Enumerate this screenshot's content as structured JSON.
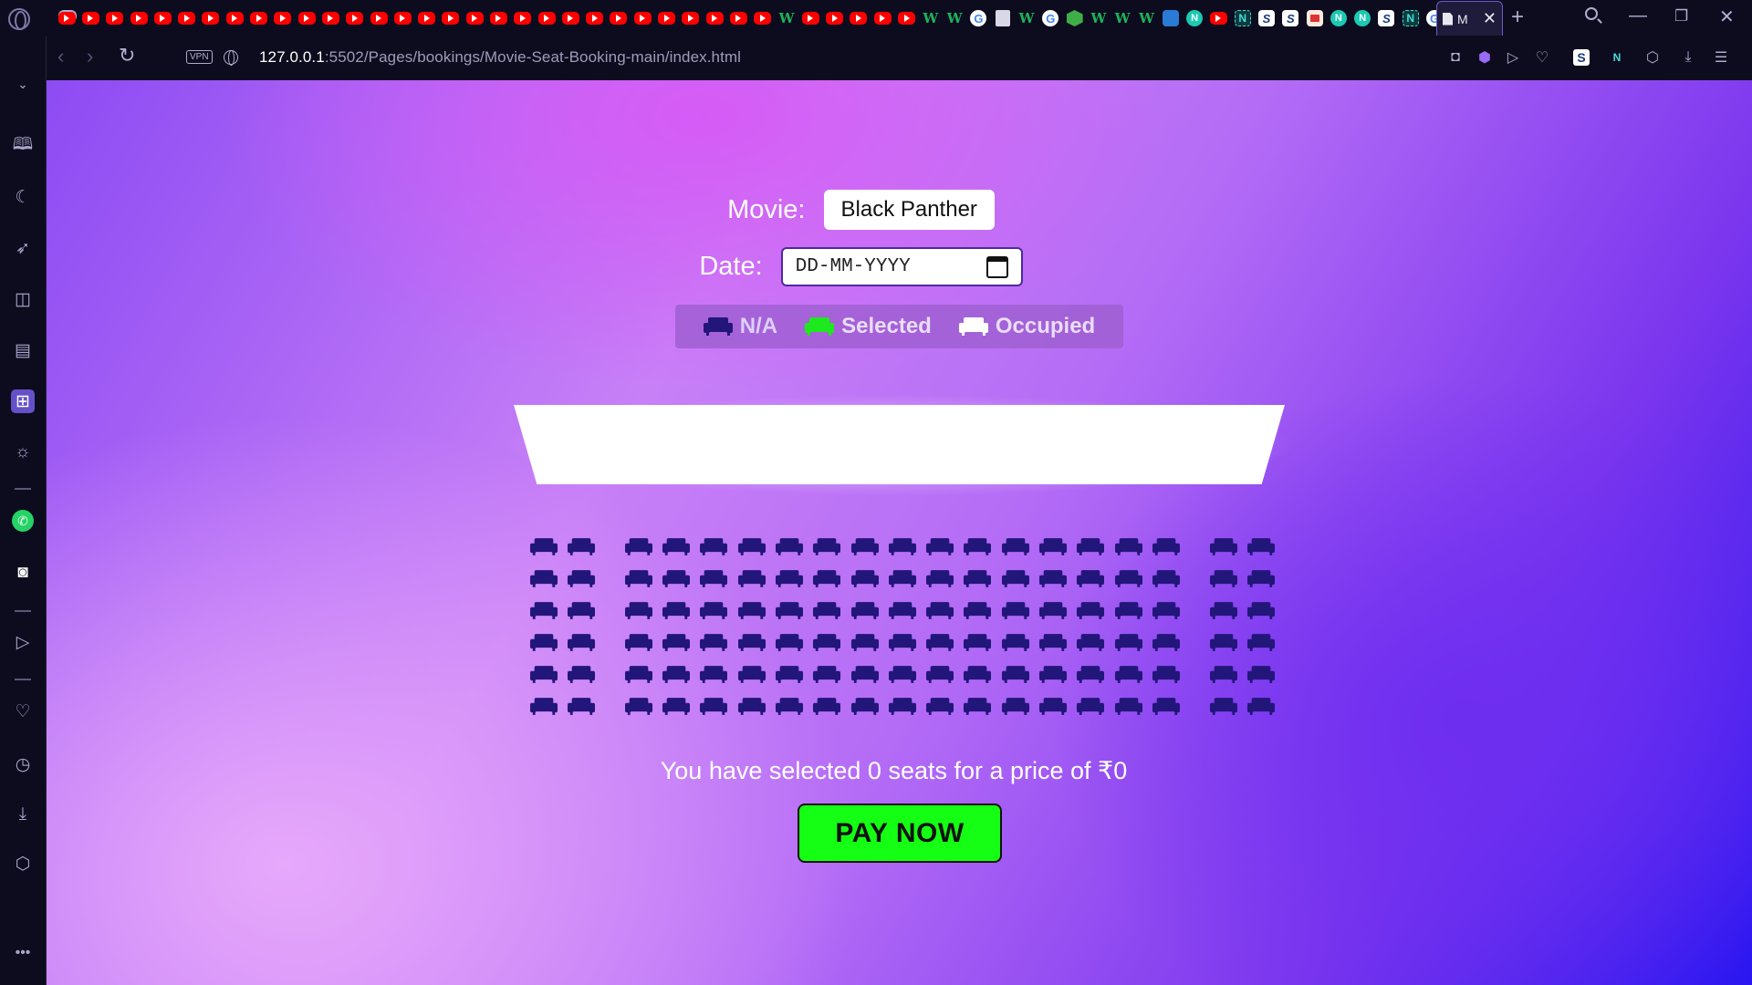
{
  "browser": {
    "active_tab_title": "M",
    "url_host": "127.0.0.1",
    "url_path": ":5502/Pages/bookings/Movie-Seat-Booking-main/index.html",
    "vpn_label": "VPN",
    "tab_favicons": [
      "yt",
      "yt",
      "yt",
      "yt",
      "yt",
      "yt",
      "yt",
      "yt",
      "yt",
      "yt",
      "yt",
      "yt",
      "yt",
      "yt",
      "yt",
      "yt",
      "yt",
      "yt",
      "yt",
      "yt",
      "yt",
      "yt",
      "yt",
      "yt",
      "yt",
      "yt",
      "yt",
      "yt",
      "yt",
      "yt",
      "w",
      "yt",
      "yt",
      "yt",
      "yt",
      "yt",
      "w",
      "w",
      "g",
      "doc",
      "w",
      "g",
      "hex",
      "w",
      "w",
      "w",
      "mini",
      "n",
      "yt",
      "nb",
      "s",
      "s",
      "gift",
      "n",
      "n",
      "s",
      "nb",
      "g"
    ]
  },
  "booking": {
    "movie_label": "Movie:",
    "movie_selected": "Black Panther",
    "date_label": "Date:",
    "date_placeholder": "DD-MM-YYYY",
    "legend": {
      "na": "N/A",
      "selected": "Selected",
      "occupied": "Occupied"
    },
    "seat_rows": 6,
    "seats_per_row": 19,
    "summary_text": "You have selected 0 seats for a price of ₹0",
    "pay_label": "PAY NOW"
  },
  "colors": {
    "seat_na": "#23167a",
    "seat_selected": "#1ee81e",
    "seat_occupied": "#ffffff",
    "pay_button": "#14ff14",
    "accent": "#7a35ee"
  }
}
